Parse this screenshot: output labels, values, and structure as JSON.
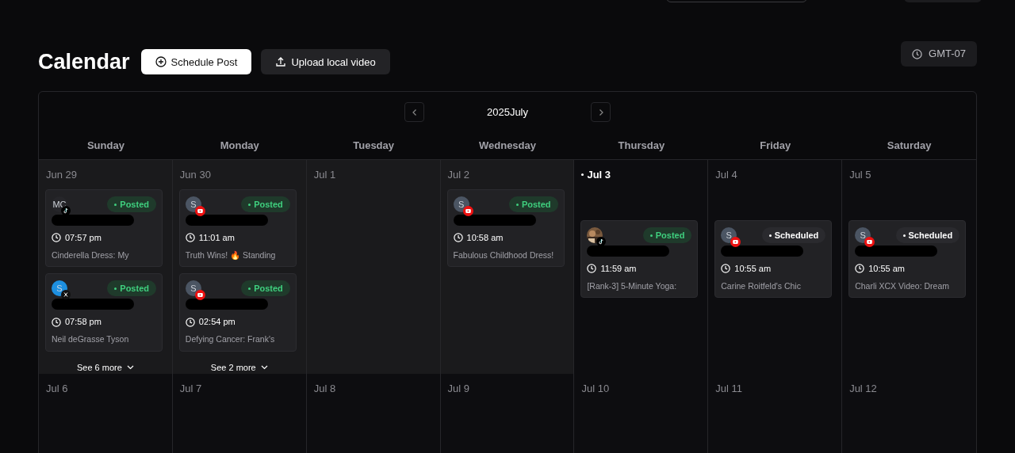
{
  "header": {
    "title": "Calendar",
    "buttons": [
      {
        "label": "Schedule Post",
        "kind": "primary"
      },
      {
        "label": "Upload local video",
        "kind": "upload"
      }
    ],
    "timezone": "GMT-07"
  },
  "calendar": {
    "month_label": "2025July",
    "weekdays": [
      "Sunday",
      "Monday",
      "Tuesday",
      "Wednesday",
      "Thursday",
      "Friday",
      "Saturday"
    ],
    "weeks": [
      {
        "days": [
          {
            "date": "Jun 29",
            "past": true,
            "today": false,
            "posts": [
              {
                "avatar": {
                  "initials": "MC",
                  "kind": "initials",
                  "color": "#26262a"
                },
                "kind": "tiktok",
                "status": "Posted",
                "time": "07:57 pm",
                "title": "Cinderella Dress: My"
              },
              {
                "avatar": {
                  "initials": "S",
                  "kind": "initials",
                  "color": "#1d8fe0"
                },
                "kind": "x",
                "status": "Posted",
                "time": "07:58 pm",
                "title": "Neil deGrasse Tyson"
              }
            ],
            "more": "See 6 more"
          },
          {
            "date": "Jun 30",
            "past": true,
            "today": false,
            "posts": [
              {
                "avatar": {
                  "initials": "S",
                  "kind": "initials",
                  "color": "#4b5563"
                },
                "kind": "youtube",
                "status": "Posted",
                "time": "11:01 am",
                "title": "Truth Wins! 🔥 Standing"
              },
              {
                "avatar": {
                  "initials": "S",
                  "kind": "initials",
                  "color": "#4b5563"
                },
                "kind": "youtube",
                "status": "Posted",
                "time": "02:54 pm",
                "title": "Defying Cancer: Frank's"
              }
            ],
            "more": "See 2 more"
          },
          {
            "date": "Jul 1",
            "past": true,
            "today": false
          },
          {
            "date": "Jul 2",
            "past": true,
            "today": false,
            "posts": [
              {
                "avatar": {
                  "initials": "S",
                  "kind": "initials",
                  "color": "#4b5563"
                },
                "kind": "youtube",
                "status": "Posted",
                "time": "10:58 am",
                "title": "Fabulous Childhood Dress!"
              }
            ]
          },
          {
            "date": "Jul 3",
            "past": false,
            "today": true,
            "posts": [
              {
                "kind": "tiktok",
                "status": "Posted",
                "time": "11:59 am",
                "title": "[Rank-3] 5-Minute Yoga:"
              }
            ]
          },
          {
            "date": "Jul 4",
            "past": false,
            "today": false,
            "posts": [
              {
                "avatar": {
                  "initials": "S",
                  "kind": "initials",
                  "color": "#4b5563"
                },
                "kind": "youtube",
                "status": "Scheduled",
                "time": "10:55 am",
                "title": "Carine Roitfeld's Chic"
              }
            ]
          },
          {
            "date": "Jul 5",
            "past": false,
            "today": false,
            "posts": [
              {
                "avatar": {
                  "initials": "S",
                  "kind": "initials",
                  "color": "#4b5563"
                },
                "kind": "youtube",
                "status": "Scheduled",
                "time": "10:55 am",
                "title": "Charli XCX Video: Dream"
              }
            ]
          }
        ]
      },
      {
        "days": [
          {
            "date": "Jul 6",
            "past": false,
            "today": false
          },
          {
            "date": "Jul 7",
            "past": false,
            "today": false
          },
          {
            "date": "Jul 8",
            "past": false,
            "today": false
          },
          {
            "date": "Jul 9",
            "past": false,
            "today": false
          },
          {
            "date": "Jul 10",
            "past": false,
            "today": false
          },
          {
            "date": "Jul 11",
            "past": false,
            "today": false
          },
          {
            "date": "Jul 12",
            "past": false,
            "today": false
          }
        ]
      }
    ]
  }
}
